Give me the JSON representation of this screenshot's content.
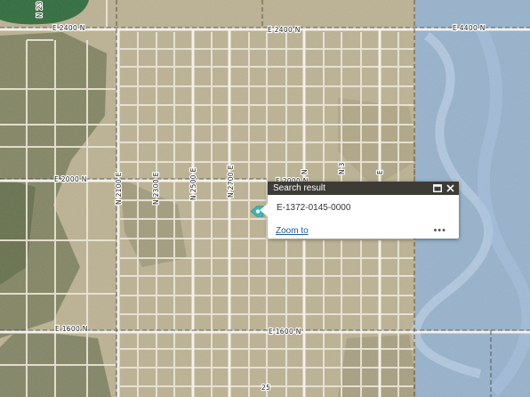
{
  "map": {
    "road_labels": {
      "e2400n_west": "E 2400 N",
      "e2400n_east": "E 2400 N",
      "e4400n": "E 4400 N",
      "e2000n_west": "E 2000 N",
      "e2000n_east": "E 2000 N",
      "e1600n_west": "E 1600 N",
      "e1600n_east": "E 1600 N",
      "n2100e": "N 2100 E",
      "n2300e": "N 2300 E",
      "n2500e": "N 2500 E",
      "n2700e": "N 2700 E",
      "n23_top": "N 23",
      "n_partial_a": "N",
      "n_partial_b": "E",
      "n_partial_c": "N 3",
      "bottom_marker": "25"
    },
    "colors": {
      "desert": "#b9ae8f",
      "scrub": "#6f7652",
      "roads": "#efeae0",
      "water": "#2e6b3b",
      "blue_overlay": "#8fb2d6",
      "marker": "#3fb4b0"
    }
  },
  "popup": {
    "title": "Search result",
    "result_id": "E-1372-0145-0000",
    "zoom_label": "Zoom to",
    "more_label": "•••",
    "maximize_icon": "maximize-icon",
    "close_icon": "close-icon"
  }
}
